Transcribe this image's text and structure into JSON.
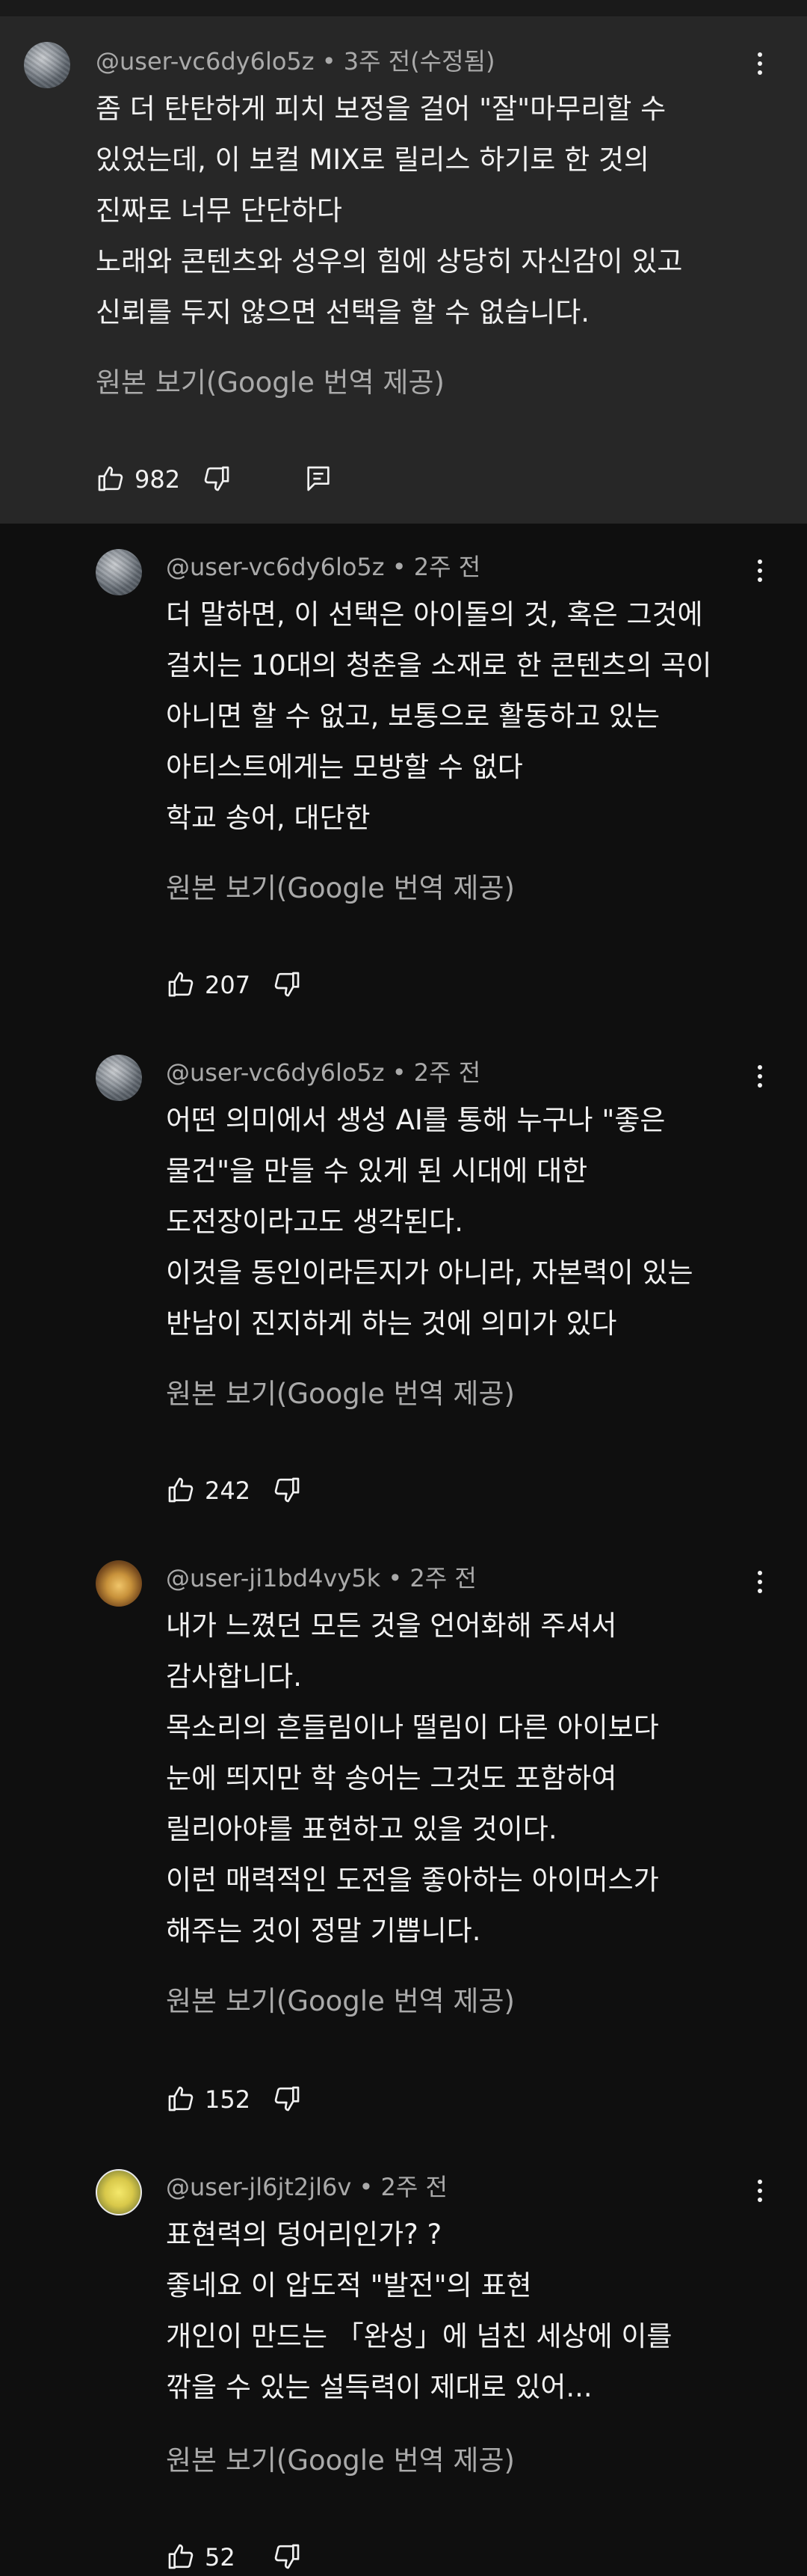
{
  "translate_label": "원본 보기(Google 번역 제공)",
  "comments": [
    {
      "author": "@user-vc6dy6lo5z",
      "time": "3주 전(수정됨)",
      "lines": [
        "좀 더 탄탄하게 피치 보정을 걸어 \"잘\"마무리할 수",
        "있었는데, 이 보컬 MIX로 릴리스 하기로 한 것의",
        "진짜로 너무 단단하다",
        "노래와 콘텐츠와 성우의 힘에 상당히 자신감이 있고",
        "신뢰를 두지 않으면 선택을 할 수 없습니다."
      ],
      "likes": "982",
      "highlighted": true
    },
    {
      "author": "@user-vc6dy6lo5z",
      "time": "2주 전",
      "lines": [
        "더 말하면, 이 선택은 아이돌의 것, 혹은 그것에",
        "걸치는 10대의 청춘을 소재로 한 콘텐츠의 곡이",
        "아니면 할 수 없고, 보통으로 활동하고 있는",
        "아티스트에게는 모방할 수 없다",
        "학교 송어, 대단한"
      ],
      "likes": "207"
    },
    {
      "author": "@user-vc6dy6lo5z",
      "time": "2주 전",
      "lines": [
        "어떤 의미에서 생성 AI를 통해 누구나 \"좋은",
        "물건\"을 만들 수 있게 된 시대에 대한",
        "도전장이라고도 생각된다.",
        "이것을 동인이라든지가 아니라, 자본력이 있는",
        "반남이 진지하게 하는 것에 의미가 있다"
      ],
      "likes": "242"
    },
    {
      "author": "@user-ji1bd4vy5k",
      "time": "2주 전",
      "lines": [
        "내가 느꼈던 모든 것을 언어화해 주셔서",
        "감사합니다.",
        "목소리의 흔들림이나 떨림이 다른 아이보다",
        "눈에 띄지만 학 송어는 그것도 포함하여",
        "릴리아야를 표현하고 있을 것이다.",
        "이런 매력적인 도전을 좋아하는 아이머스가",
        "해주는 것이 정말 기쁩니다."
      ],
      "likes": "152"
    },
    {
      "author": "@user-jl6jt2jl6v",
      "time": "2주 전",
      "lines": [
        "표현력의 덩어리인가? ?",
        "좋네요 이 압도적 \"발전\"의 표현",
        "개인이 만드는 「완성」에 넘친 세상에 이를",
        "깎을 수 있는 설득력이 제대로 있어..."
      ],
      "likes": "52"
    }
  ]
}
